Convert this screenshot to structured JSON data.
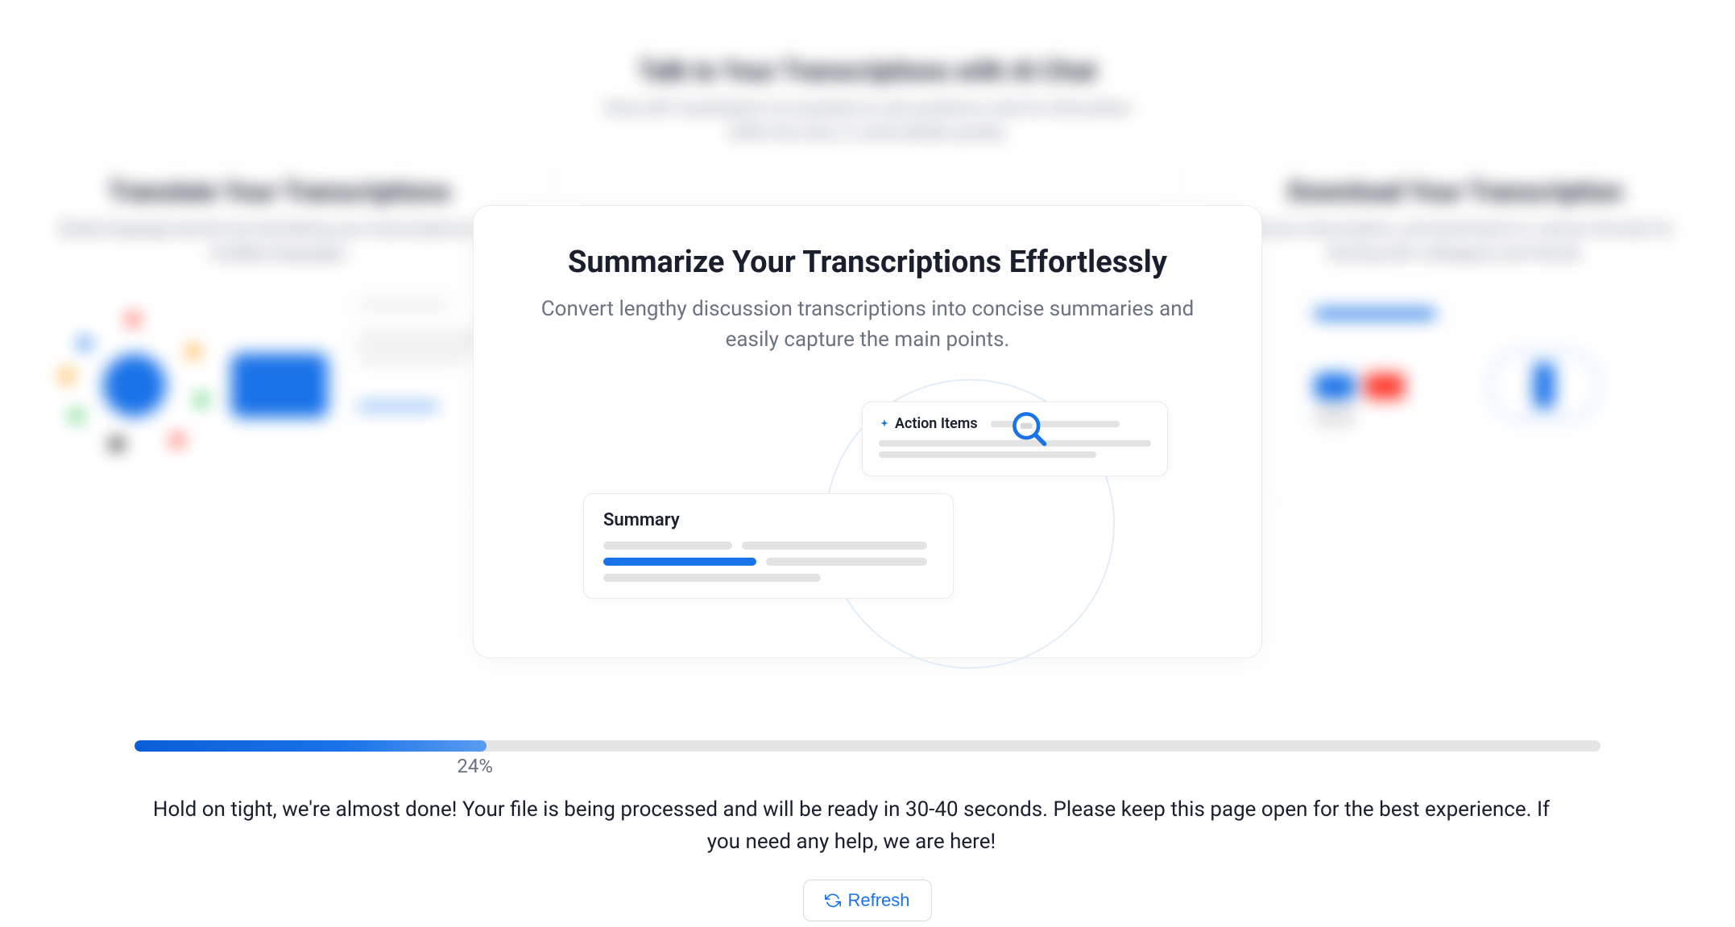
{
  "background_cards": {
    "left": {
      "title": "Translate Your Transcriptions",
      "description": "Break language barriers by translating your transcriptions into multiple languages."
    },
    "center": {
      "title": "Talk to Your Transcriptions with AI Chat",
      "description": "Chat with Transkriptor's AI assistant to ask questions, look for information within the chat, or verify details quickly."
    },
    "right": {
      "title": "Download Your Transcription",
      "description": "Edit your transcription, and download it in various formats for sharing with colleagues and friends."
    }
  },
  "main_card": {
    "title": "Summarize Your Transcriptions Effortlessly",
    "subtitle": "Convert lengthy discussion transcriptions into concise summaries and easily capture the main points.",
    "action_items_label": "Action Items",
    "summary_label": "Summary"
  },
  "progress": {
    "percent": 24,
    "percent_label": "24%",
    "status_message": "Hold on tight, we're almost done! Your file is being processed and will be ready in 30-40 seconds. Please keep this page open for the best experience. If you need any help, we are here!",
    "refresh_label": "Refresh"
  }
}
